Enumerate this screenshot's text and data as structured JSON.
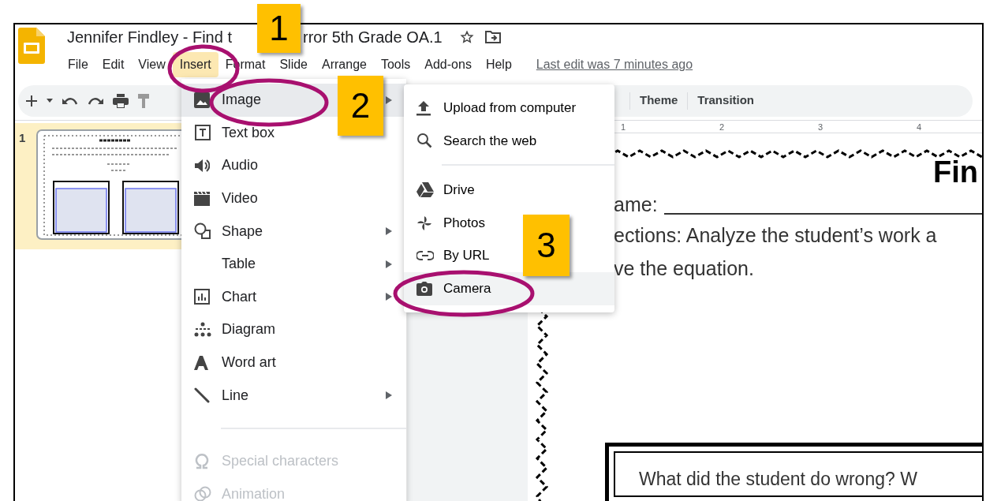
{
  "window": {
    "title_parts": [
      "Jennifer Findley - Find t",
      "rror 5th Grade OA.1"
    ]
  },
  "menu_bar": [
    {
      "label": "File",
      "selected": false
    },
    {
      "label": "Edit",
      "selected": false
    },
    {
      "label": "View",
      "selected": false
    },
    {
      "label": "Insert",
      "selected": true
    },
    {
      "label": "Format",
      "selected": false
    },
    {
      "label": "Slide",
      "selected": false
    },
    {
      "label": "Arrange",
      "selected": false
    },
    {
      "label": "Tools",
      "selected": false
    },
    {
      "label": "Add-ons",
      "selected": false
    },
    {
      "label": "Help",
      "selected": false
    }
  ],
  "last_edit": "Last edit was 7 minutes ago",
  "toolbar": {
    "buttons": [
      "Theme",
      "Transition"
    ]
  },
  "ruler": [
    "1",
    "2",
    "3",
    "4"
  ],
  "filmstrip": [
    {
      "number": "1",
      "selected": true
    }
  ],
  "insert_menu": [
    {
      "label": "Image",
      "submenu": true,
      "disabled": false,
      "selected": true
    },
    {
      "label": "Text box",
      "submenu": false,
      "disabled": false,
      "selected": false
    },
    {
      "label": "Audio",
      "submenu": false,
      "disabled": false,
      "selected": false
    },
    {
      "label": "Video",
      "submenu": false,
      "disabled": false,
      "selected": false
    },
    {
      "label": "Shape",
      "submenu": true,
      "disabled": false,
      "selected": false
    },
    {
      "label": "Table",
      "submenu": true,
      "disabled": false,
      "selected": false
    },
    {
      "label": "Chart",
      "submenu": true,
      "disabled": false,
      "selected": false
    },
    {
      "label": "Diagram",
      "submenu": false,
      "disabled": false,
      "selected": false
    },
    {
      "label": "Word art",
      "submenu": false,
      "disabled": false,
      "selected": false
    },
    {
      "label": "Line",
      "submenu": true,
      "disabled": false,
      "selected": false
    },
    {
      "label": "Special characters",
      "submenu": false,
      "disabled": true,
      "selected": false
    },
    {
      "label": "Animation",
      "submenu": false,
      "disabled": true,
      "selected": false
    }
  ],
  "image_submenu": [
    {
      "label": "Upload from computer",
      "selected": false
    },
    {
      "label": "Search the web",
      "selected": false
    },
    {
      "label": "Drive",
      "selected": false
    },
    {
      "label": "Photos",
      "selected": false
    },
    {
      "label": "By URL",
      "selected": false
    },
    {
      "label": "Camera",
      "selected": true
    }
  ],
  "slide": {
    "heading": "Fin",
    "name_label": "ame:",
    "lines": [
      "ections: Analyze the student’s work a",
      "ve the equation."
    ],
    "question": "What did the student do wrong? W"
  },
  "annotations": [
    {
      "label": "1"
    },
    {
      "label": "2"
    },
    {
      "label": "3"
    }
  ]
}
